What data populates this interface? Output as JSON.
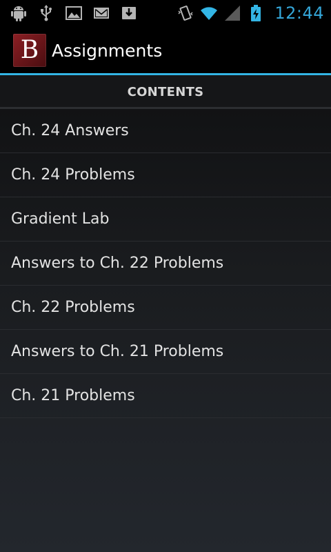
{
  "status_bar": {
    "left_icons": [
      "android-debug-icon",
      "usb-icon",
      "image-icon",
      "gmail-icon",
      "download-icon"
    ],
    "right_icons": [
      "vibrate-icon",
      "wifi-icon",
      "signal-icon",
      "battery-charging-icon"
    ],
    "time": "12:44",
    "clock_color": "#34a6d8"
  },
  "action_bar": {
    "app_icon_letter": "B",
    "title": "Assignments",
    "accent_color": "#33b5e5"
  },
  "section": {
    "header": "CONTENTS"
  },
  "list": {
    "items": [
      {
        "label": "Ch. 24 Answers"
      },
      {
        "label": "Ch. 24 Problems"
      },
      {
        "label": "Gradient Lab"
      },
      {
        "label": "Answers to Ch. 22 Problems"
      },
      {
        "label": "Ch. 22 Problems"
      },
      {
        "label": "Answers to Ch. 21 Problems"
      },
      {
        "label": "Ch. 21 Problems"
      }
    ]
  }
}
